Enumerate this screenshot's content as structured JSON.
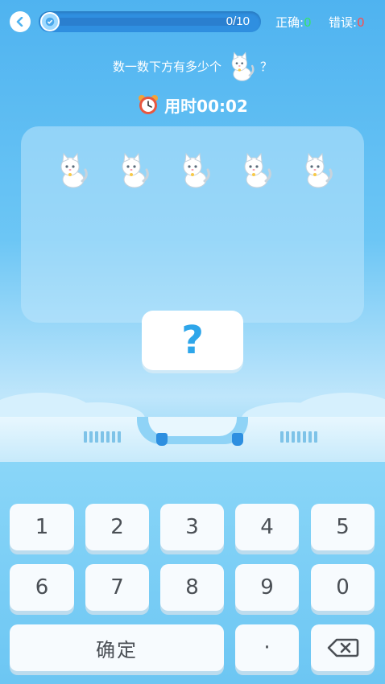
{
  "header": {
    "back_icon": "back-arrow-icon",
    "progress": {
      "text": "0/10",
      "current": 0,
      "total": 10,
      "icon": "badge-icon"
    },
    "correct": {
      "label": "正确:",
      "value": "0",
      "color": "#36e36a"
    },
    "wrong": {
      "label": "错误:",
      "value": "0",
      "color": "#ff4b4b"
    }
  },
  "question": {
    "prefix": "数一数下方有多少个",
    "suffix": "？",
    "icon": "cat-icon"
  },
  "timer": {
    "label": "用时00:02",
    "icon": "alarm-clock-icon"
  },
  "panel": {
    "item_icon": "cat-icon",
    "item_count": 5
  },
  "answer": {
    "value": "?"
  },
  "keypad": {
    "keys": [
      "1",
      "2",
      "3",
      "4",
      "5",
      "6",
      "7",
      "8",
      "9",
      "0"
    ],
    "confirm_label": "确定",
    "dot_label": "·",
    "delete_icon": "backspace-icon"
  }
}
